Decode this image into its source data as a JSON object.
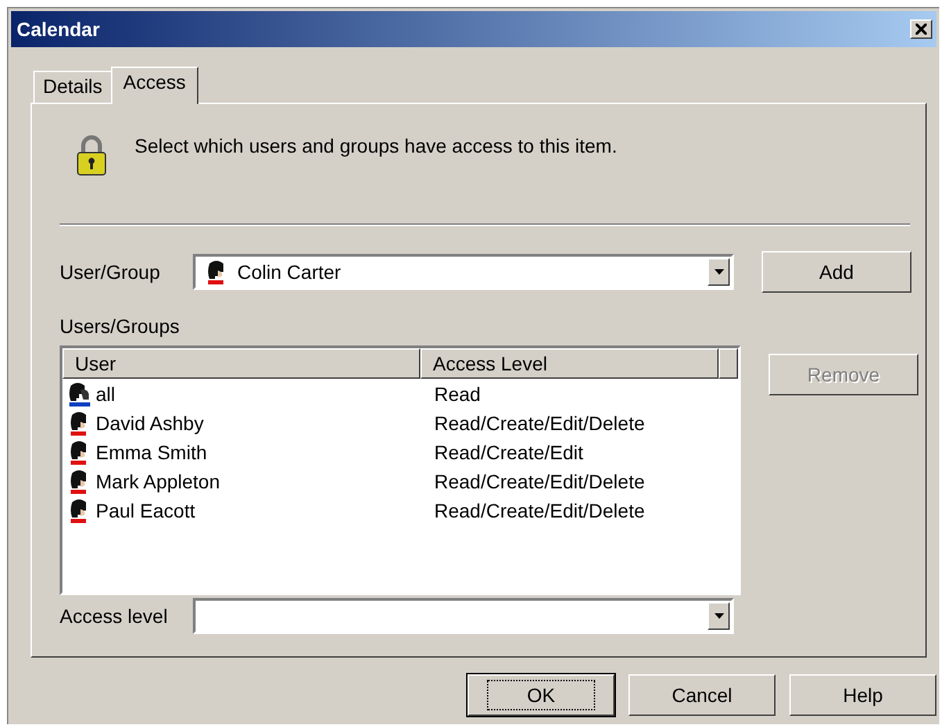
{
  "window": {
    "title": "Calendar"
  },
  "tabs": [
    {
      "label": "Details",
      "selected": false
    },
    {
      "label": "Access",
      "selected": true
    }
  ],
  "description": "Select which users and groups have access to this item.",
  "user_group": {
    "label": "User/Group",
    "value": "Colin Carter"
  },
  "add_button": {
    "label": "Add",
    "disabled": false
  },
  "list": {
    "label": "Users/Groups",
    "columns": [
      "User",
      "Access Level"
    ],
    "rows": [
      {
        "kind": "group",
        "user": "all",
        "access": "Read",
        "selected": false
      },
      {
        "kind": "user",
        "user": "David Ashby",
        "access": "Read/Create/Edit/Delete",
        "selected": false
      },
      {
        "kind": "user",
        "user": "Emma Smith",
        "access": "Read/Create/Edit",
        "selected": false
      },
      {
        "kind": "user",
        "user": "Mark Appleton",
        "access": "Read/Create/Edit/Delete",
        "selected": false
      },
      {
        "kind": "user",
        "user": "Paul Eacott",
        "access": "Read/Create/Edit/Delete",
        "selected": false
      }
    ]
  },
  "remove_button": {
    "label": "Remove",
    "disabled": true
  },
  "access_level": {
    "label": "Access level"
  },
  "buttons": [
    {
      "label": "OK",
      "default": true
    },
    {
      "label": "Cancel",
      "default": false
    },
    {
      "label": "Help",
      "default": false
    }
  ]
}
